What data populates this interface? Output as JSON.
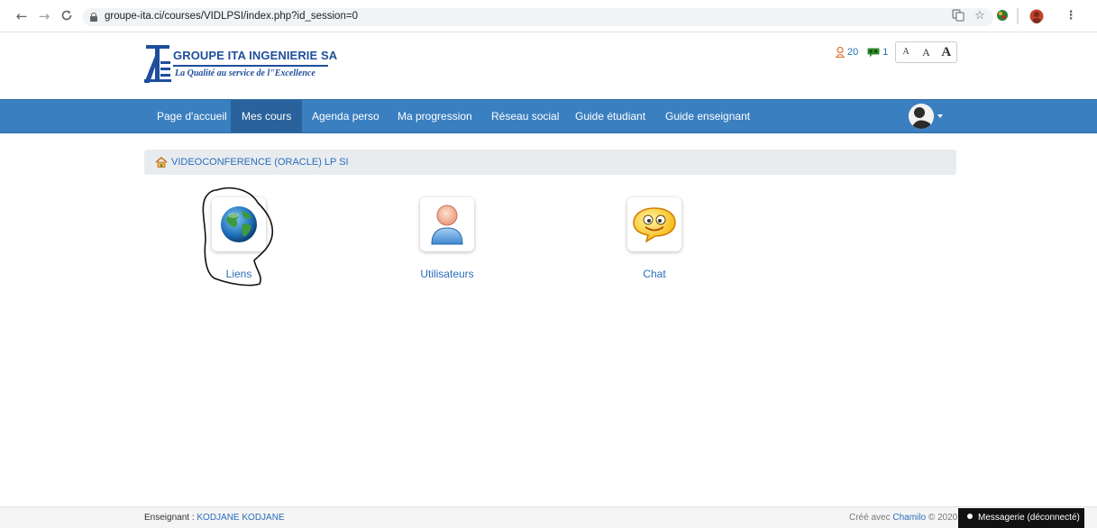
{
  "browser": {
    "back_icon": "arrow-left-icon",
    "forward_icon": "arrow-right-icon",
    "reload_icon": "reload-icon",
    "url": "groupe-ita.ci/courses/VIDLPSI/index.php?id_session=0"
  },
  "site": {
    "logo_title": "GROUPE ITA INGENIERIE SA",
    "logo_tagline": "La Qualité au service de l\"Excellence",
    "brand_color": "#1f4e9a",
    "nav_color": "#3a7fc0"
  },
  "header": {
    "users_count": "20",
    "messages_count": "1",
    "font_small": "A",
    "font_medium": "A",
    "font_large": "A"
  },
  "nav": {
    "items": [
      {
        "label": "Page d'accueil",
        "active": false
      },
      {
        "label": "Mes cours",
        "active": true
      },
      {
        "label": "Agenda perso",
        "active": false
      },
      {
        "label": "Ma progression",
        "active": false
      },
      {
        "label": "Réseau social",
        "active": false
      },
      {
        "label": "Guide étudiant",
        "active": false
      },
      {
        "label": "Guide enseignant",
        "active": false
      }
    ]
  },
  "breadcrumb": {
    "icon": "home-icon",
    "label": "VIDEOCONFERENCE (ORACLE) LP SI"
  },
  "tools": [
    {
      "label": "Liens",
      "icon": "globe-icon"
    },
    {
      "label": "Utilisateurs",
      "icon": "user-icon"
    },
    {
      "label": "Chat",
      "icon": "chat-bubble-icon"
    }
  ],
  "footer": {
    "teacher_label": "Enseignant : ",
    "teacher_name": "KODJANE KODJANE",
    "created_prefix": "Créé avec ",
    "created_link": "Chamilo",
    "copyright": " © 2020",
    "chat_status": "Messagerie (déconnecté)"
  }
}
